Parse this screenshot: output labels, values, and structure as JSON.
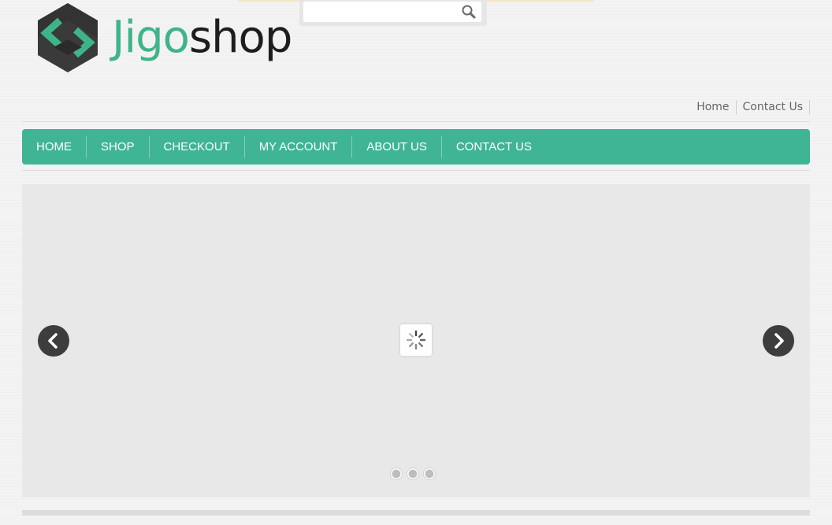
{
  "brand": {
    "name_part1": "Jigo",
    "name_part2": "shop",
    "color_primary": "#3db588",
    "color_dark": "#1e1e1e"
  },
  "search": {
    "value": "",
    "placeholder": "",
    "button_icon": "search-icon"
  },
  "top_links": [
    {
      "label": "Home"
    },
    {
      "label": "Contact Us"
    }
  ],
  "nav": {
    "color": "#40b595",
    "items": [
      {
        "label": "HOME"
      },
      {
        "label": "SHOP"
      },
      {
        "label": "CHECKOUT"
      },
      {
        "label": "MY ACCOUNT"
      },
      {
        "label": "ABOUT US"
      },
      {
        "label": "CONTACT US"
      }
    ]
  },
  "slider": {
    "prev_icon": "chevron-left-icon",
    "next_icon": "chevron-right-icon",
    "loader_icon": "spinner-icon",
    "slide_count": 3
  }
}
